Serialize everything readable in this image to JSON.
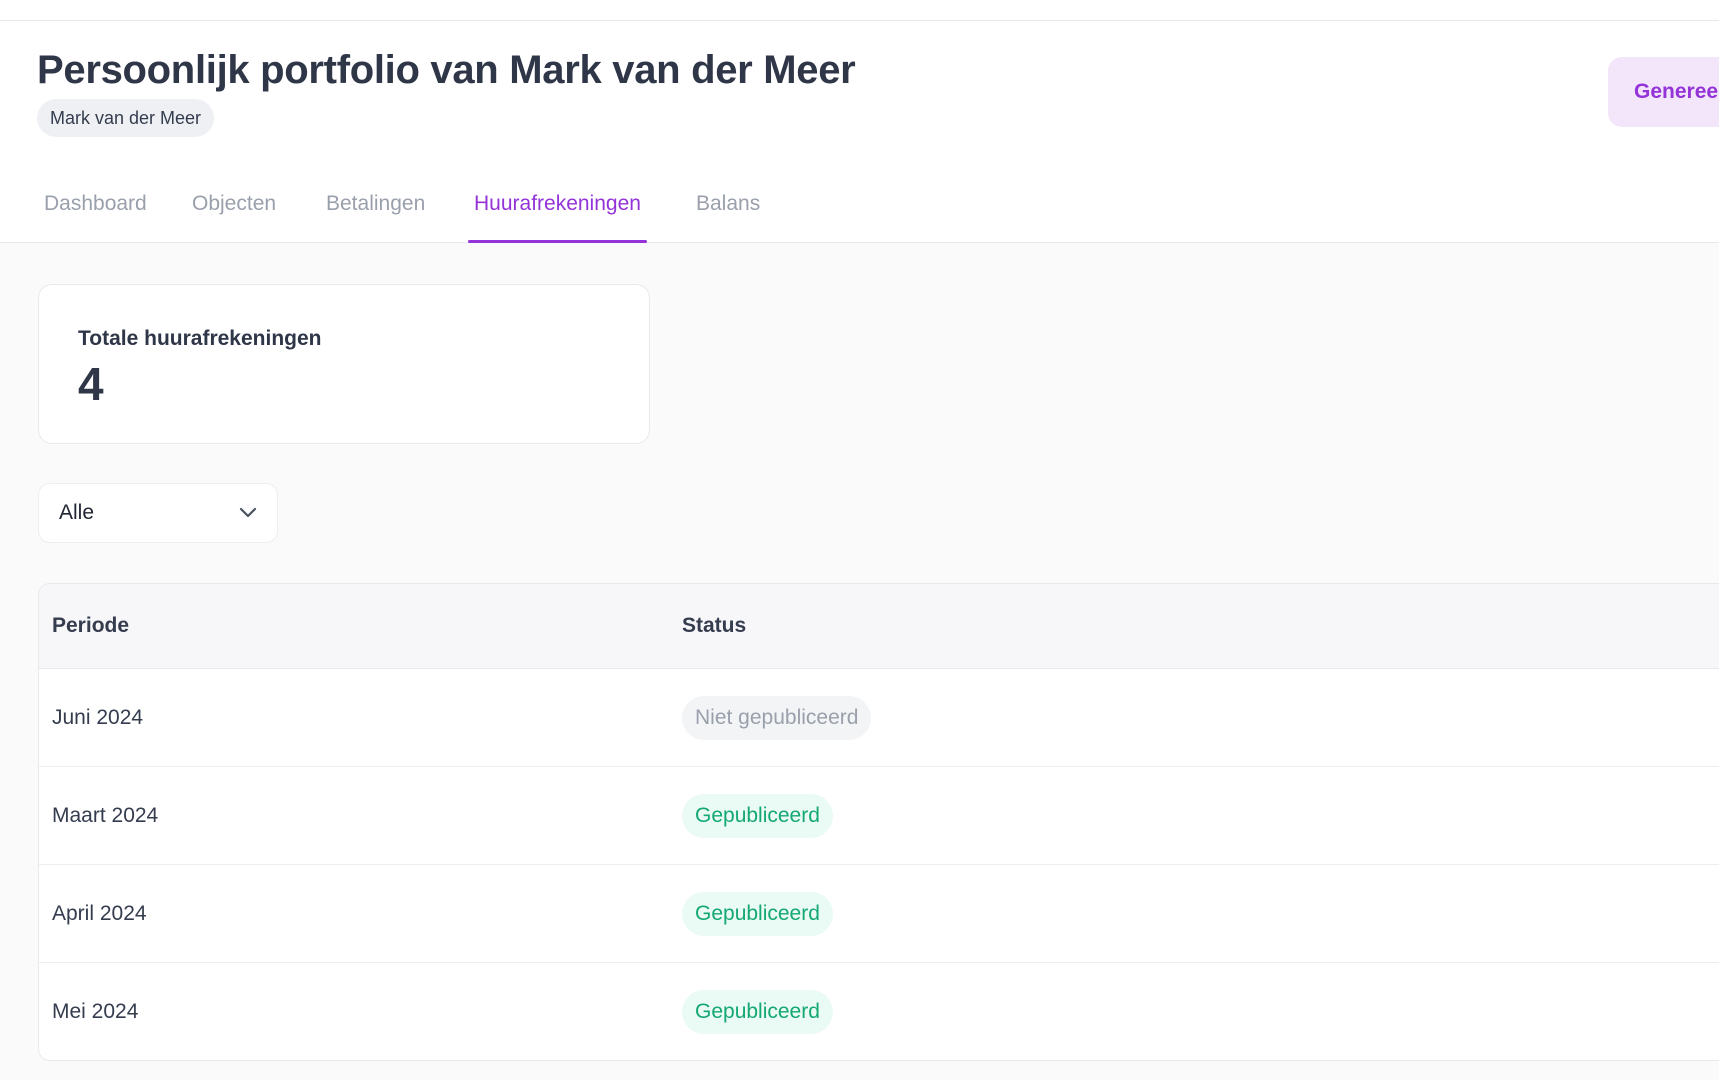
{
  "header": {
    "title": "Persoonlijk portfolio van Mark van der Meer",
    "owner": "Mark van der Meer",
    "action_label": "Generee"
  },
  "tabs": [
    {
      "label": "Dashboard",
      "active": false
    },
    {
      "label": "Objecten",
      "active": false
    },
    {
      "label": "Betalingen",
      "active": false
    },
    {
      "label": "Huurafrekeningen",
      "active": true
    },
    {
      "label": "Balans",
      "active": false
    }
  ],
  "stats": {
    "label": "Totale huurafrekeningen",
    "value": "4"
  },
  "filter": {
    "selected": "Alle",
    "icon": "chevron-down-icon"
  },
  "table": {
    "columns": [
      "Periode",
      "Status"
    ],
    "rows": [
      {
        "period": "Juni 2024",
        "status": "Niet gepubliceerd",
        "status_type": "unpublished"
      },
      {
        "period": "Maart 2024",
        "status": "Gepubliceerd",
        "status_type": "published"
      },
      {
        "period": "April 2024",
        "status": "Gepubliceerd",
        "status_type": "published"
      },
      {
        "period": "Mei 2024",
        "status": "Gepubliceerd",
        "status_type": "published"
      }
    ]
  },
  "colors": {
    "accent": "#9333d8",
    "published": "#14a873",
    "unpublished": "#9aa0ab"
  }
}
